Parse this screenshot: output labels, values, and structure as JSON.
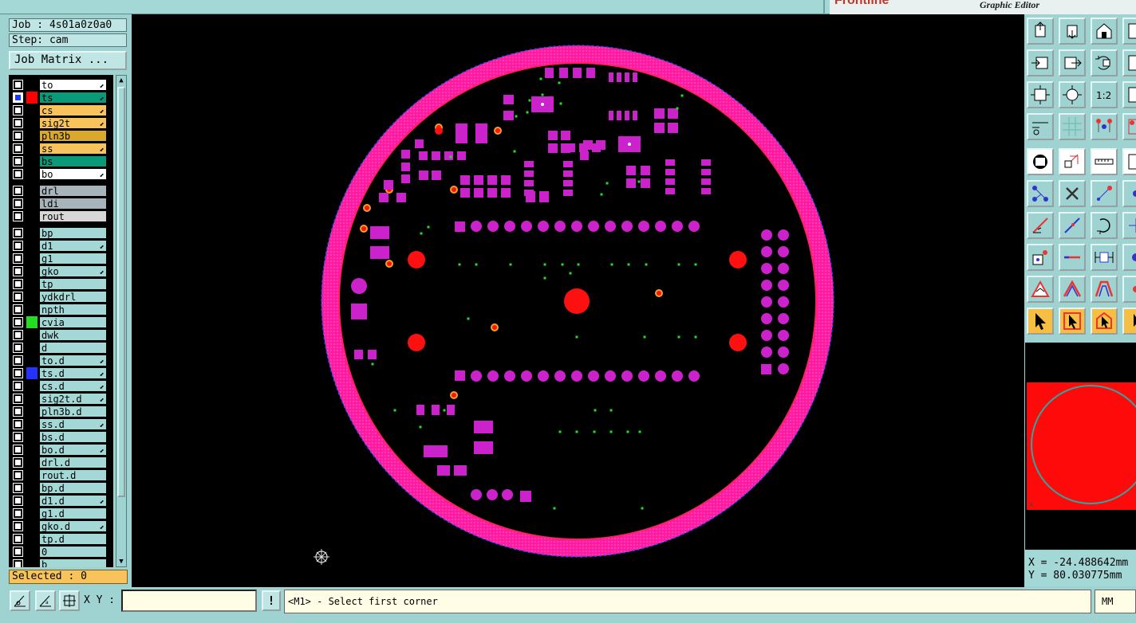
{
  "brand": {
    "logo": "Frontline",
    "subtitle": "Graphic Editor"
  },
  "job": {
    "label": "Job : 4s01a0z0a0",
    "step": "Step: cam",
    "matrix_button": "Job Matrix ..."
  },
  "layers": [
    {
      "name": "to",
      "color": "#ffffff",
      "swatch": "",
      "arrow": true,
      "active": false
    },
    {
      "name": "ts",
      "color": "#0a9a7a",
      "swatch": "#ff0000",
      "arrow": true,
      "active": true
    },
    {
      "name": "cs",
      "color": "#f7c35a",
      "swatch": "",
      "arrow": true,
      "active": false
    },
    {
      "name": "sig2t",
      "color": "#f7c35a",
      "swatch": "",
      "arrow": true,
      "active": false
    },
    {
      "name": "pln3b",
      "color": "#d9a92b",
      "swatch": "",
      "arrow": false,
      "active": false
    },
    {
      "name": "ss",
      "color": "#f7c35a",
      "swatch": "",
      "arrow": true,
      "active": false
    },
    {
      "name": "bs",
      "color": "#0a9a7a",
      "swatch": "",
      "arrow": false,
      "active": false
    },
    {
      "name": "bo",
      "color": "#ffffff",
      "swatch": "",
      "arrow": true,
      "active": false
    },
    {
      "name": "drl",
      "color": "#a7b4ba",
      "swatch": "",
      "arrow": false,
      "active": false
    },
    {
      "name": "ldi",
      "color": "#a7b4ba",
      "swatch": "",
      "arrow": false,
      "active": false
    },
    {
      "name": "rout",
      "color": "#d7d7d7",
      "swatch": "",
      "arrow": false,
      "active": false
    },
    {
      "name": "bp",
      "color": "#a3d8d6",
      "swatch": "",
      "arrow": false,
      "active": false
    },
    {
      "name": "d1",
      "color": "#a3d8d6",
      "swatch": "",
      "arrow": true,
      "active": false
    },
    {
      "name": "g1",
      "color": "#a3d8d6",
      "swatch": "",
      "arrow": false,
      "active": false
    },
    {
      "name": "gko",
      "color": "#a3d8d6",
      "swatch": "",
      "arrow": true,
      "active": false
    },
    {
      "name": "tp",
      "color": "#a3d8d6",
      "swatch": "",
      "arrow": false,
      "active": false
    },
    {
      "name": "ydkdrl",
      "color": "#a3d8d6",
      "swatch": "",
      "arrow": false,
      "active": false
    },
    {
      "name": "npth",
      "color": "#a3d8d6",
      "swatch": "",
      "arrow": false,
      "active": false
    },
    {
      "name": "cvia",
      "color": "#a3d8d6",
      "swatch": "#22dd22",
      "arrow": false,
      "active": false
    },
    {
      "name": "dwk",
      "color": "#a3d8d6",
      "swatch": "",
      "arrow": false,
      "active": false
    },
    {
      "name": "d",
      "color": "#a3d8d6",
      "swatch": "",
      "arrow": false,
      "active": false
    },
    {
      "name": "to.d",
      "color": "#a3d8d6",
      "swatch": "",
      "arrow": true,
      "active": false
    },
    {
      "name": "ts.d",
      "color": "#a3d8d6",
      "swatch": "#2233ff",
      "arrow": true,
      "active": false
    },
    {
      "name": "cs.d",
      "color": "#a3d8d6",
      "swatch": "",
      "arrow": true,
      "active": false
    },
    {
      "name": "sig2t.d",
      "color": "#a3d8d6",
      "swatch": "",
      "arrow": true,
      "active": false
    },
    {
      "name": "pln3b.d",
      "color": "#a3d8d6",
      "swatch": "",
      "arrow": false,
      "active": false
    },
    {
      "name": "ss.d",
      "color": "#a3d8d6",
      "swatch": "",
      "arrow": true,
      "active": false
    },
    {
      "name": "bs.d",
      "color": "#a3d8d6",
      "swatch": "",
      "arrow": false,
      "active": false
    },
    {
      "name": "bo.d",
      "color": "#a3d8d6",
      "swatch": "",
      "arrow": true,
      "active": false
    },
    {
      "name": "drl.d",
      "color": "#a3d8d6",
      "swatch": "",
      "arrow": false,
      "active": false
    },
    {
      "name": "rout.d",
      "color": "#a3d8d6",
      "swatch": "",
      "arrow": false,
      "active": false
    },
    {
      "name": "bp.d",
      "color": "#a3d8d6",
      "swatch": "",
      "arrow": false,
      "active": false
    },
    {
      "name": "d1.d",
      "color": "#a3d8d6",
      "swatch": "",
      "arrow": true,
      "active": false
    },
    {
      "name": "g1.d",
      "color": "#a3d8d6",
      "swatch": "",
      "arrow": false,
      "active": false
    },
    {
      "name": "gko.d",
      "color": "#a3d8d6",
      "swatch": "",
      "arrow": true,
      "active": false
    },
    {
      "name": "tp.d",
      "color": "#a3d8d6",
      "swatch": "",
      "arrow": false,
      "active": false
    },
    {
      "name": "0",
      "color": "#a3d8d6",
      "swatch": "",
      "arrow": false,
      "active": false
    },
    {
      "name": "b",
      "color": "#a3d8d6",
      "swatch": "",
      "arrow": false,
      "active": false
    }
  ],
  "selected": "Selected : 0",
  "toolbar": {
    "buttons": [
      "home-window-icon",
      "save-window-icon",
      "house-icon",
      "window-icon",
      "zoom-left-icon",
      "zoom-right-icon",
      "undo-view-icon",
      "window-icon-2",
      "fit-zoom-icon",
      "center-zoom-icon",
      "one-to-one-icon",
      "window-icon-3",
      "measure-icon",
      "grid-icon",
      "snap-icon",
      "snap-icon-2",
      "pad-icon",
      "polygon-icon",
      "ruler-icon",
      "window-icon-4",
      "connect-icon",
      "cross-icon",
      "line-point-icon",
      "line-point-icon-2",
      "angle-icon",
      "slash-icon",
      "arc-icon",
      "arc-icon-2",
      "point-box-icon",
      "line-h-icon",
      "dimension-icon",
      "dimension-icon-2",
      "triangle-icon",
      "triangle-icon-2",
      "arch-icon",
      "arch-icon-2",
      "pointer-icon",
      "pointer-box-icon",
      "pointer-shape-icon",
      "pointer-icon-2"
    ],
    "one_to_one_label": "1:2"
  },
  "coords": {
    "x": "X = -24.488642mm",
    "y": "Y = 80.030775mm"
  },
  "bottom": {
    "xy_label": "X Y :",
    "xy_value": "",
    "excl": "!",
    "status": "<M1> - Select first corner",
    "units": "MM"
  },
  "colors": {
    "board": "#ff1493",
    "pad": "#cc22cc",
    "red": "#ff1010",
    "via": "#22dd22",
    "background": "#000000"
  }
}
